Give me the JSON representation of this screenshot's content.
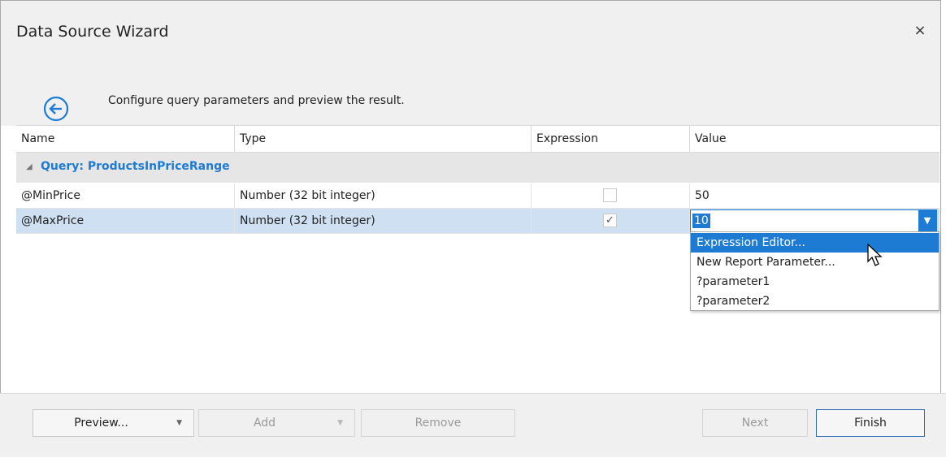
{
  "window": {
    "title": "Data Source Wizard",
    "close_glyph": "×"
  },
  "header": {
    "description": "Configure query parameters and preview the result.",
    "back_icon": "back-arrow-icon"
  },
  "grid": {
    "columns": [
      "Name",
      "Type",
      "Expression",
      "Value"
    ],
    "group": {
      "label": "Query: ProductsInPriceRange",
      "expander": "◢"
    },
    "rows": [
      {
        "name": "@MinPrice",
        "type": "Number (32 bit integer)",
        "expression": false,
        "value": "50"
      },
      {
        "name": "@MaxPrice",
        "type": "Number (32 bit integer)",
        "expression": true,
        "value": "10"
      }
    ]
  },
  "editor": {
    "value": "10",
    "dropdown_glyph": "▼"
  },
  "dropdown": {
    "items": [
      "Expression Editor...",
      "New Report Parameter...",
      "?parameter1",
      "?parameter2"
    ],
    "highlighted_index": 0
  },
  "footer": {
    "preview_label": "Preview...",
    "add_label": "Add",
    "remove_label": "Remove",
    "next_label": "Next",
    "finish_label": "Finish",
    "split_arrow": "▼"
  },
  "colors": {
    "accent": "#1e7bd4",
    "selected_row": "#cfe0f3",
    "group_bg": "#e6e6e6"
  }
}
